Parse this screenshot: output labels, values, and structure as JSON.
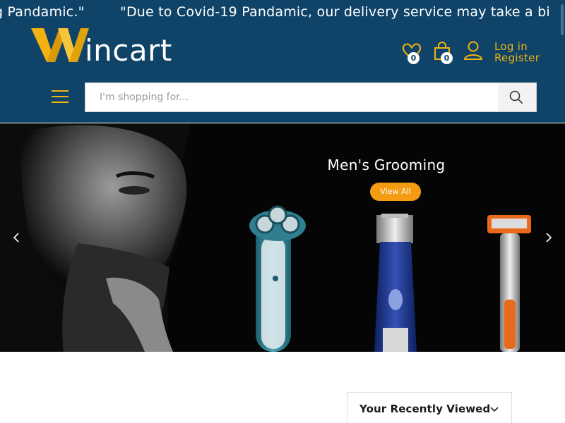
{
  "announcement": {
    "text_tail": "g Pandamic.\"",
    "text_main": "\"Due to Covid-19 Pandamic, our delivery service may take a bi"
  },
  "brand": {
    "name": "incart",
    "logo_letter": "W",
    "accent": "#f3b20f",
    "header_bg": "#0f4468"
  },
  "header": {
    "wishlist_count": "0",
    "cart_count": "0",
    "login_label": "Log in",
    "register_label": "Register"
  },
  "search": {
    "placeholder": "I'm shopping for..."
  },
  "banner": {
    "title": "Men's Grooming",
    "button_label": "View All",
    "button_color": "#f39c12"
  },
  "recently_viewed": {
    "label": "Your Recently Viewed"
  },
  "icons": {
    "wishlist": "heart-icon",
    "cart": "shopping-bag-icon",
    "account": "user-icon",
    "menu": "hamburger-menu-icon",
    "search": "search-icon",
    "prev": "chevron-left-icon",
    "next": "chevron-right-icon",
    "expand": "chevron-down-icon"
  }
}
